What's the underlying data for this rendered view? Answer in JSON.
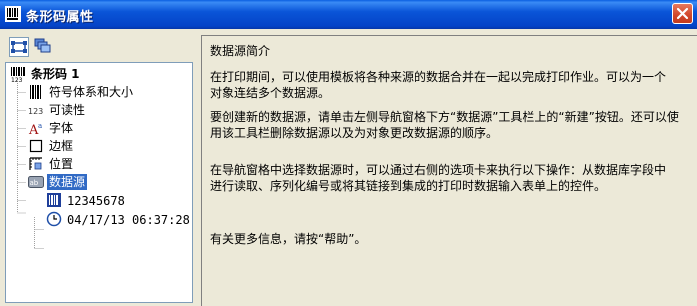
{
  "window": {
    "title": "条形码属性"
  },
  "tree": {
    "root": {
      "label": "条形码 1"
    },
    "items": [
      {
        "label": "符号体系和大小"
      },
      {
        "label": "可读性"
      },
      {
        "label": "字体"
      },
      {
        "label": "边框"
      },
      {
        "label": "位置"
      },
      {
        "label": "数据源"
      }
    ],
    "sources": [
      {
        "label": "12345678"
      },
      {
        "label": "04/17/13 06:37:28"
      }
    ]
  },
  "help": {
    "title": "数据源简介",
    "paragraphs": [
      {
        "lines": [
          "在打印期间，可以使用模板将各种来源的数据合并在一起以完成打印作业。可以为一个",
          "对象连结多个数据源。"
        ]
      },
      {
        "lines": [
          "要创建新的数据源，请单击左侧导航窗格下方“数据源”工具栏上的“新建”按钮。还可以使",
          "用该工具栏删除数据源以及为对象更改数据源的顺序。"
        ]
      },
      {
        "lines": [
          "在导航窗格中选择数据源时，可以通过右侧的选项卡来执行以下操作：从数据库字段中",
          "进行读取、序列化编号或将其链接到集成的打印时数据输入表单上的控件。"
        ]
      },
      {
        "lines": [
          "有关更多信息，请按“帮助”。"
        ]
      }
    ]
  }
}
